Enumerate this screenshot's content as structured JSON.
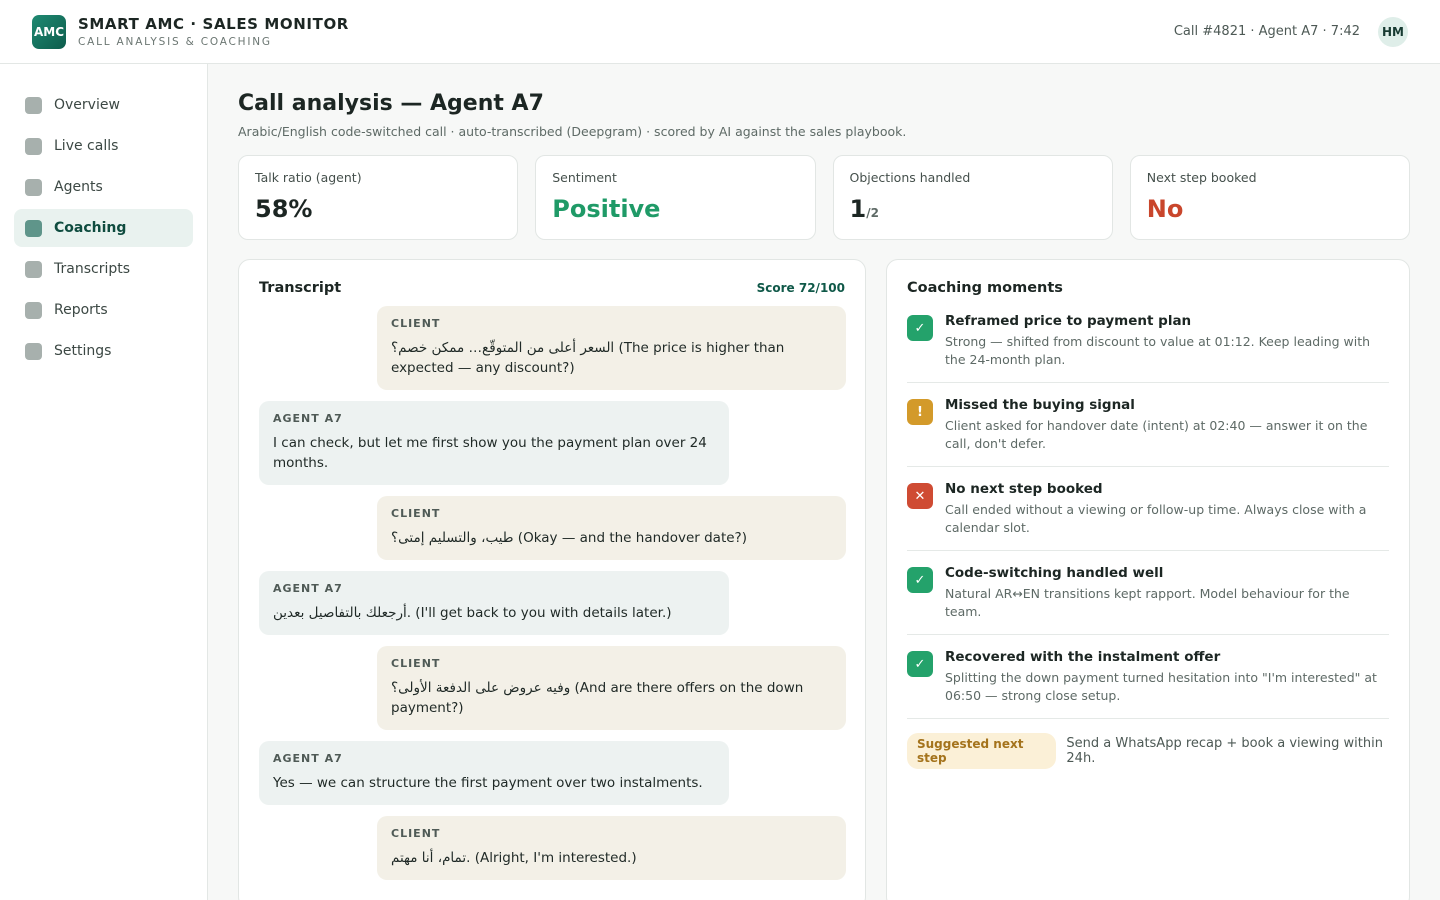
{
  "header": {
    "logo_text": "AMC",
    "brand_title": "SMART AMC · SALES MONITOR",
    "brand_subtitle": "CALL ANALYSIS & COACHING",
    "call_meta": "Call #4821 · Agent A7 · 7:42",
    "avatar_initials": "HM"
  },
  "sidebar": {
    "items": [
      {
        "label": "Overview",
        "active": false
      },
      {
        "label": "Live calls",
        "active": false
      },
      {
        "label": "Agents",
        "active": false
      },
      {
        "label": "Coaching",
        "active": true
      },
      {
        "label": "Transcripts",
        "active": false
      },
      {
        "label": "Reports",
        "active": false
      },
      {
        "label": "Settings",
        "active": false
      }
    ]
  },
  "page": {
    "title": "Call analysis — Agent A7",
    "subtitle": "Arabic/English code-switched call · auto-transcribed (Deepgram) · scored by AI against the sales playbook."
  },
  "metrics": [
    {
      "label": "Talk ratio (agent)",
      "value": "58%"
    },
    {
      "label": "Sentiment",
      "value": "Positive"
    },
    {
      "label": "Objections handled",
      "value": "1",
      "denominator": "/2"
    },
    {
      "label": "Next step booked",
      "value": "No"
    }
  ],
  "transcript": {
    "title": "Transcript",
    "score": "Score 72/100",
    "messages": [
      {
        "speaker": "CLIENT",
        "text": "السعر أعلى من المتوقّع… ممكن خصم؟ (The price is higher than expected — any discount?)"
      },
      {
        "speaker": "AGENT A7",
        "text": "I can check, but let me first show you the payment plan over 24 months."
      },
      {
        "speaker": "CLIENT",
        "text": "طيب، والتسليم إمتى؟ (Okay — and the handover date?)"
      },
      {
        "speaker": "AGENT A7",
        "text": "أرجعلك بالتفاصيل بعدين. (I'll get back to you with details later.)"
      },
      {
        "speaker": "CLIENT",
        "text": "وفيه عروض على الدفعة الأولى؟ (And are there offers on the down payment?)"
      },
      {
        "speaker": "AGENT A7",
        "text": "Yes — we can structure the first payment over two instalments."
      },
      {
        "speaker": "CLIENT",
        "text": "تمام، أنا مهتم. (Alright, I'm interested.)"
      }
    ]
  },
  "coaching": {
    "title": "Coaching moments",
    "moments": [
      {
        "status": "good",
        "icon": "✓",
        "title": "Reframed price to payment plan",
        "desc": "Strong — shifted from discount to value at 01:12. Keep leading with the 24-month plan."
      },
      {
        "status": "warn",
        "icon": "!",
        "title": "Missed the buying signal",
        "desc": "Client asked for handover date (intent) at 02:40 — answer it on the call, don't defer."
      },
      {
        "status": "bad",
        "icon": "✕",
        "title": "No next step booked",
        "desc": "Call ended without a viewing or follow-up time. Always close with a calendar slot."
      },
      {
        "status": "good",
        "icon": "✓",
        "title": "Code-switching handled well",
        "desc": "Natural AR↔EN transitions kept rapport. Model behaviour for the team."
      },
      {
        "status": "good",
        "icon": "✓",
        "title": "Recovered with the instalment offer",
        "desc": "Splitting the down payment turned hesitation into \"I'm interested\" at 06:50 — strong close setup."
      }
    ],
    "next_step_label": "Suggested next step",
    "next_step_text": "Send a WhatsApp recap + book a viewing within 24h."
  }
}
